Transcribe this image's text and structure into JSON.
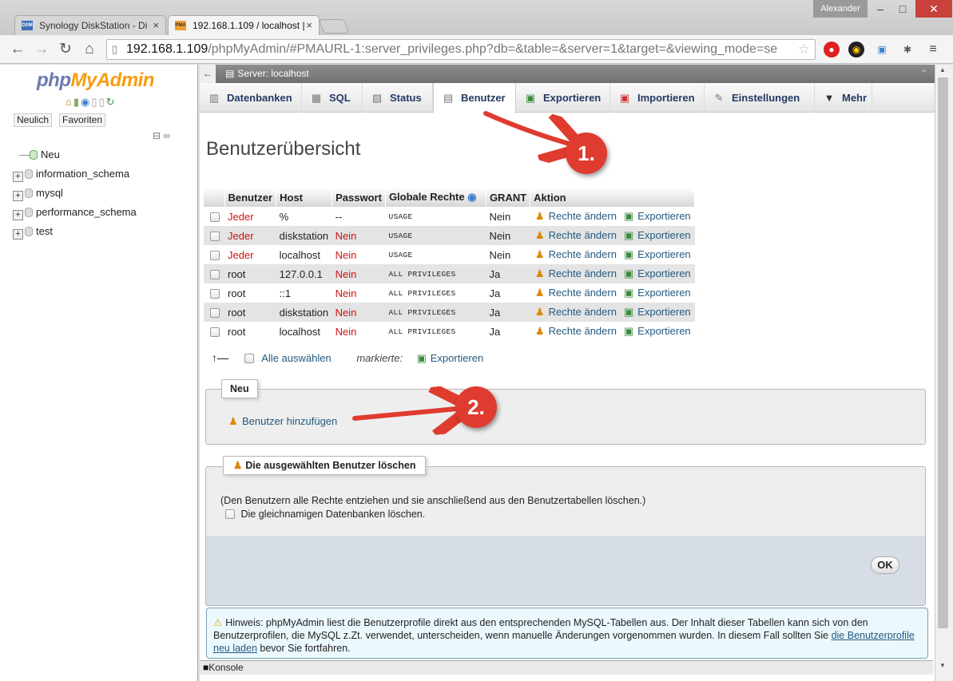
{
  "browser": {
    "tabs": [
      {
        "label": "Synology DiskStation - Di",
        "favicon": "DSM"
      },
      {
        "label": "192.168.1.109 / localhost |",
        "favicon": "PMA"
      }
    ],
    "user_badge": "Alexander",
    "url_host": "192.168.1.109",
    "url_path": "/phpMyAdmin/#PMAURL-1:server_privileges.php?db=&table=&server=1&target=&viewing_mode=se"
  },
  "sidebar": {
    "logo_php": "php",
    "logo_myadmin": "MyAdmin",
    "buttons": [
      "Neulich",
      "Favoriten"
    ],
    "tree": [
      "Neu",
      "information_schema",
      "mysql",
      "performance_schema",
      "test"
    ]
  },
  "server_bar": {
    "label": "Server: localhost"
  },
  "menu": [
    {
      "label": "Datenbanken",
      "icon": "database-icon"
    },
    {
      "label": "SQL",
      "icon": "sql-icon"
    },
    {
      "label": "Status",
      "icon": "status-icon"
    },
    {
      "label": "Benutzer",
      "icon": "users-icon"
    },
    {
      "label": "Exportieren",
      "icon": "export-icon"
    },
    {
      "label": "Importieren",
      "icon": "import-icon"
    },
    {
      "label": "Einstellungen",
      "icon": "wrench-icon"
    },
    {
      "label": "Mehr",
      "icon": "caret-down-icon"
    }
  ],
  "page_title": "Benutzerübersicht",
  "table": {
    "headers": [
      "Benutzer",
      "Host",
      "Passwort",
      "Globale Rechte",
      "GRANT",
      "Aktion"
    ],
    "rows": [
      {
        "user": "Jeder",
        "host": "%",
        "password": "--",
        "rights": "USAGE",
        "grant": "Nein"
      },
      {
        "user": "Jeder",
        "host": "diskstation",
        "password": "Nein",
        "rights": "USAGE",
        "grant": "Nein"
      },
      {
        "user": "Jeder",
        "host": "localhost",
        "password": "Nein",
        "rights": "USAGE",
        "grant": "Nein"
      },
      {
        "user": "root",
        "host": "127.0.0.1",
        "password": "Nein",
        "rights": "ALL PRIVILEGES",
        "grant": "Ja"
      },
      {
        "user": "root",
        "host": "::1",
        "password": "Nein",
        "rights": "ALL PRIVILEGES",
        "grant": "Ja"
      },
      {
        "user": "root",
        "host": "diskstation",
        "password": "Nein",
        "rights": "ALL PRIVILEGES",
        "grant": "Ja"
      },
      {
        "user": "root",
        "host": "localhost",
        "password": "Nein",
        "rights": "ALL PRIVILEGES",
        "grant": "Ja"
      }
    ],
    "action_edit": "Rechte ändern",
    "action_export": "Exportieren"
  },
  "selection": {
    "select_all": "Alle auswählen",
    "marked": "markierte:",
    "export": "Exportieren"
  },
  "new_section": {
    "legend": "Neu",
    "add_user": "Benutzer hinzufügen"
  },
  "delete_section": {
    "legend": "Die ausgewählten Benutzer löschen",
    "description": "(Den Benutzern alle Rechte entziehen und sie anschließend aus den Benutzertabellen löschen.)",
    "checkbox": "Die gleichnamigen Datenbanken löschen.",
    "ok": "OK"
  },
  "notice": {
    "text": "Hinweis: phpMyAdmin liest die Benutzerprofile direkt aus den entsprechenden MySQL-Tabellen aus. Der Inhalt dieser Tabellen kann sich von den Benutzerprofilen, die MySQL z.Zt. verwendet, unterscheiden, wenn manuelle Änderungen vorgenommen wurden. In diesem Fall sollten Sie ",
    "link": "die Benutzerprofile neu laden",
    "after": " bevor Sie fortfahren."
  },
  "console": "Konsole",
  "annotations": [
    "1.",
    "2."
  ],
  "colors": {
    "annotation": "#e03b2f",
    "link": "#235a81",
    "no_password": "#cc1111"
  }
}
